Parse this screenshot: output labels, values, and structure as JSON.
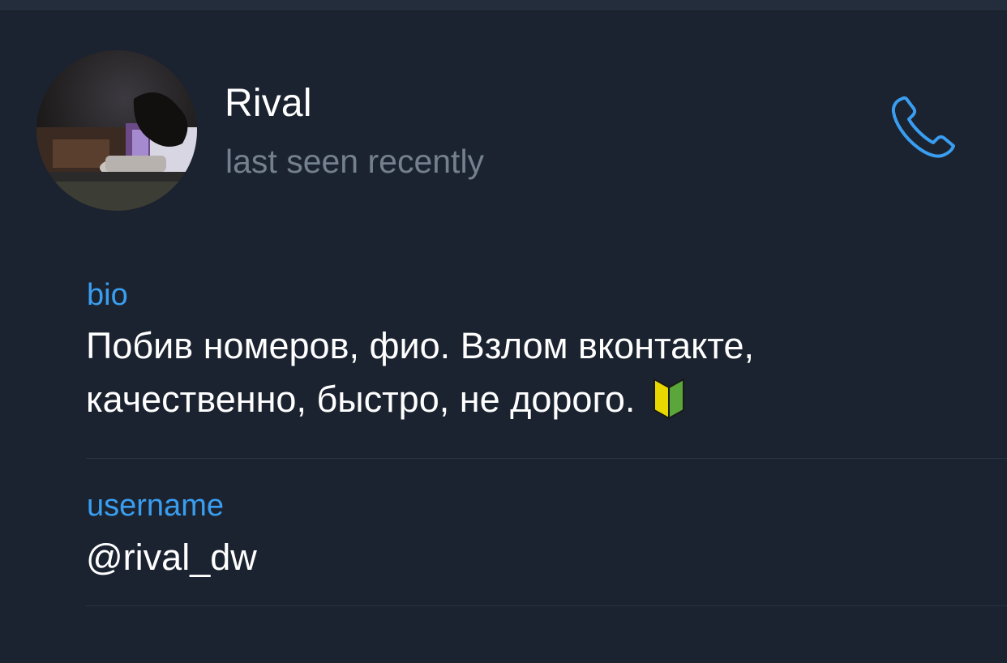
{
  "profile": {
    "name": "Rival",
    "status": "last seen recently"
  },
  "actions": {
    "call_icon": "phone-icon"
  },
  "bio": {
    "label": "bio",
    "line1": "Побив номеров, фио. Взлом вконтакте,",
    "line2": "качественно, быстро, не дорого.",
    "emoji_icon": "beginner-badge-icon"
  },
  "username": {
    "label": "username",
    "value": "@rival_dw"
  },
  "colors": {
    "background": "#1b2330",
    "accent": "#3a9ef0",
    "secondary_text": "#75808f"
  }
}
